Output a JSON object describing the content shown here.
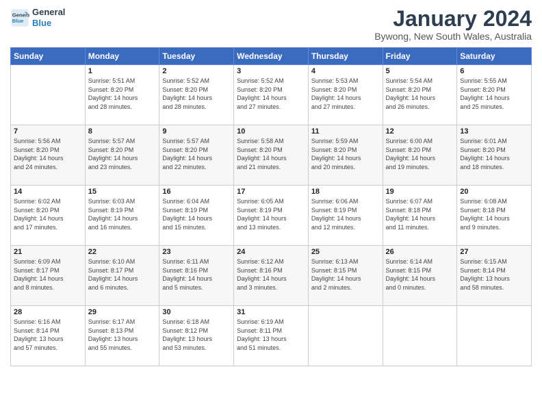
{
  "logo": {
    "line1": "General",
    "line2": "Blue"
  },
  "title": "January 2024",
  "location": "Bywong, New South Wales, Australia",
  "days_header": [
    "Sunday",
    "Monday",
    "Tuesday",
    "Wednesday",
    "Thursday",
    "Friday",
    "Saturday"
  ],
  "weeks": [
    [
      {
        "day": "",
        "info": ""
      },
      {
        "day": "1",
        "info": "Sunrise: 5:51 AM\nSunset: 8:20 PM\nDaylight: 14 hours\nand 28 minutes."
      },
      {
        "day": "2",
        "info": "Sunrise: 5:52 AM\nSunset: 8:20 PM\nDaylight: 14 hours\nand 28 minutes."
      },
      {
        "day": "3",
        "info": "Sunrise: 5:52 AM\nSunset: 8:20 PM\nDaylight: 14 hours\nand 27 minutes."
      },
      {
        "day": "4",
        "info": "Sunrise: 5:53 AM\nSunset: 8:20 PM\nDaylight: 14 hours\nand 27 minutes."
      },
      {
        "day": "5",
        "info": "Sunrise: 5:54 AM\nSunset: 8:20 PM\nDaylight: 14 hours\nand 26 minutes."
      },
      {
        "day": "6",
        "info": "Sunrise: 5:55 AM\nSunset: 8:20 PM\nDaylight: 14 hours\nand 25 minutes."
      }
    ],
    [
      {
        "day": "7",
        "info": "Sunrise: 5:56 AM\nSunset: 8:20 PM\nDaylight: 14 hours\nand 24 minutes."
      },
      {
        "day": "8",
        "info": "Sunrise: 5:57 AM\nSunset: 8:20 PM\nDaylight: 14 hours\nand 23 minutes."
      },
      {
        "day": "9",
        "info": "Sunrise: 5:57 AM\nSunset: 8:20 PM\nDaylight: 14 hours\nand 22 minutes."
      },
      {
        "day": "10",
        "info": "Sunrise: 5:58 AM\nSunset: 8:20 PM\nDaylight: 14 hours\nand 21 minutes."
      },
      {
        "day": "11",
        "info": "Sunrise: 5:59 AM\nSunset: 8:20 PM\nDaylight: 14 hours\nand 20 minutes."
      },
      {
        "day": "12",
        "info": "Sunrise: 6:00 AM\nSunset: 8:20 PM\nDaylight: 14 hours\nand 19 minutes."
      },
      {
        "day": "13",
        "info": "Sunrise: 6:01 AM\nSunset: 8:20 PM\nDaylight: 14 hours\nand 18 minutes."
      }
    ],
    [
      {
        "day": "14",
        "info": "Sunrise: 6:02 AM\nSunset: 8:20 PM\nDaylight: 14 hours\nand 17 minutes."
      },
      {
        "day": "15",
        "info": "Sunrise: 6:03 AM\nSunset: 8:19 PM\nDaylight: 14 hours\nand 16 minutes."
      },
      {
        "day": "16",
        "info": "Sunrise: 6:04 AM\nSunset: 8:19 PM\nDaylight: 14 hours\nand 15 minutes."
      },
      {
        "day": "17",
        "info": "Sunrise: 6:05 AM\nSunset: 8:19 PM\nDaylight: 14 hours\nand 13 minutes."
      },
      {
        "day": "18",
        "info": "Sunrise: 6:06 AM\nSunset: 8:19 PM\nDaylight: 14 hours\nand 12 minutes."
      },
      {
        "day": "19",
        "info": "Sunrise: 6:07 AM\nSunset: 8:18 PM\nDaylight: 14 hours\nand 11 minutes."
      },
      {
        "day": "20",
        "info": "Sunrise: 6:08 AM\nSunset: 8:18 PM\nDaylight: 14 hours\nand 9 minutes."
      }
    ],
    [
      {
        "day": "21",
        "info": "Sunrise: 6:09 AM\nSunset: 8:17 PM\nDaylight: 14 hours\nand 8 minutes."
      },
      {
        "day": "22",
        "info": "Sunrise: 6:10 AM\nSunset: 8:17 PM\nDaylight: 14 hours\nand 6 minutes."
      },
      {
        "day": "23",
        "info": "Sunrise: 6:11 AM\nSunset: 8:16 PM\nDaylight: 14 hours\nand 5 minutes."
      },
      {
        "day": "24",
        "info": "Sunrise: 6:12 AM\nSunset: 8:16 PM\nDaylight: 14 hours\nand 3 minutes."
      },
      {
        "day": "25",
        "info": "Sunrise: 6:13 AM\nSunset: 8:15 PM\nDaylight: 14 hours\nand 2 minutes."
      },
      {
        "day": "26",
        "info": "Sunrise: 6:14 AM\nSunset: 8:15 PM\nDaylight: 14 hours\nand 0 minutes."
      },
      {
        "day": "27",
        "info": "Sunrise: 6:15 AM\nSunset: 8:14 PM\nDaylight: 13 hours\nand 58 minutes."
      }
    ],
    [
      {
        "day": "28",
        "info": "Sunrise: 6:16 AM\nSunset: 8:14 PM\nDaylight: 13 hours\nand 57 minutes."
      },
      {
        "day": "29",
        "info": "Sunrise: 6:17 AM\nSunset: 8:13 PM\nDaylight: 13 hours\nand 55 minutes."
      },
      {
        "day": "30",
        "info": "Sunrise: 6:18 AM\nSunset: 8:12 PM\nDaylight: 13 hours\nand 53 minutes."
      },
      {
        "day": "31",
        "info": "Sunrise: 6:19 AM\nSunset: 8:11 PM\nDaylight: 13 hours\nand 51 minutes."
      },
      {
        "day": "",
        "info": ""
      },
      {
        "day": "",
        "info": ""
      },
      {
        "day": "",
        "info": ""
      }
    ]
  ]
}
